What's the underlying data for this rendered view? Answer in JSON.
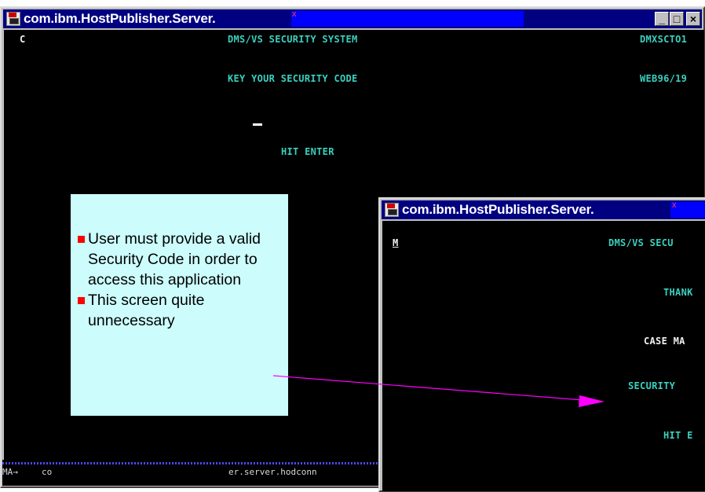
{
  "window_back": {
    "title": "com.ibm.HostPublisher.Server.",
    "title_suffix": "x",
    "buttons": {
      "minimize": "_",
      "restore": "□",
      "close": "×"
    },
    "screen_lines": [
      {
        "text": "C"
      },
      {
        "text": "DMS/VS SECURITY SYSTEM"
      },
      {
        "text": "DMXSCTO1"
      },
      {
        "text": "KEY YOUR SECURITY CODE"
      },
      {
        "text": "WEB96/19"
      },
      {
        "text": "HIT ENTER"
      }
    ],
    "status": {
      "left": "MA→",
      "mid": "co",
      "right": "er.server.hodconn"
    }
  },
  "window_front": {
    "title": "com.ibm.HostPublisher.Server.",
    "title_suffix": "x",
    "screen_lines": [
      {
        "text": "M"
      },
      {
        "text": "DMS/VS SECU"
      },
      {
        "text": "THANK"
      },
      {
        "text": "CASE MA"
      },
      {
        "text": "SECURITY"
      },
      {
        "text": "HIT E"
      }
    ]
  },
  "callout": {
    "bullets": [
      "User must provide a valid Security Code in order to access this application",
      "This screen quite unnecessary"
    ]
  },
  "colors": {
    "titlebar": "#000080",
    "title_highlight": "#0000ff",
    "screen_bg": "#000000",
    "screen_text": "#3ad0c0",
    "callout_bg": "#ccfcfc",
    "bullet": "#ff0000",
    "arrow": "#ff00ff"
  }
}
